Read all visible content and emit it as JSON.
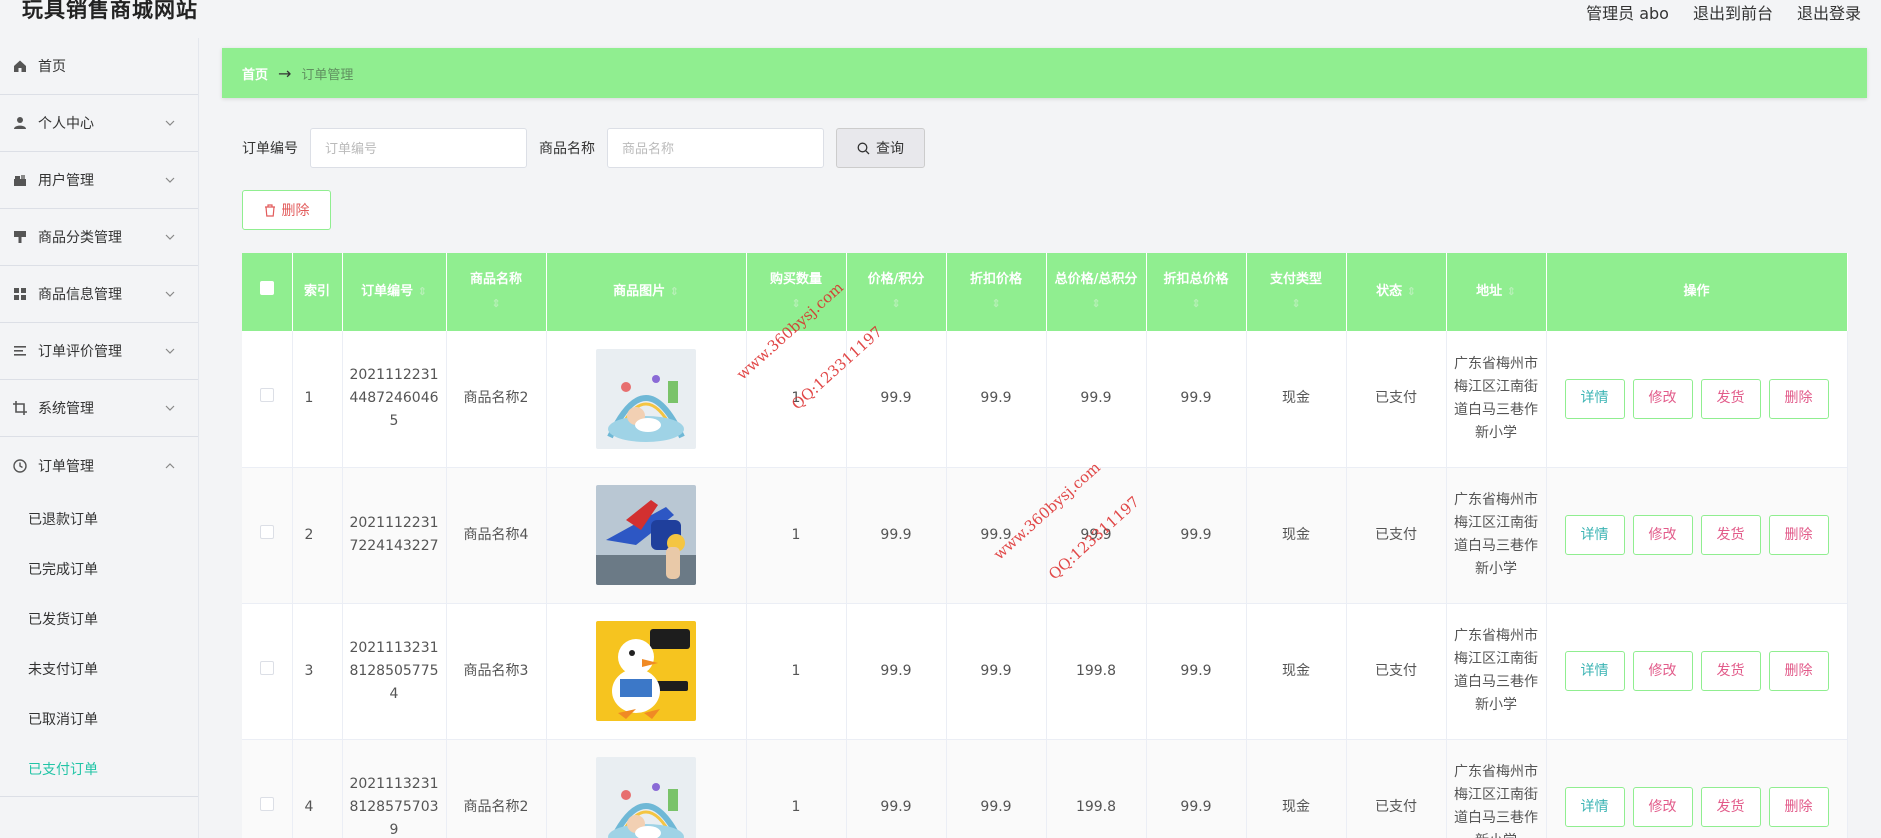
{
  "header": {
    "site_title": "玩具销售商城网站",
    "admin_label": "管理员 abo",
    "front_link": "退出到前台",
    "logout_link": "退出登录"
  },
  "sidebar": {
    "items": [
      {
        "label": "首页",
        "icon": "home-icon"
      },
      {
        "label": "个人中心",
        "icon": "user-icon"
      },
      {
        "label": "用户管理",
        "icon": "users-icon"
      },
      {
        "label": "商品分类管理",
        "icon": "category-icon"
      },
      {
        "label": "商品信息管理",
        "icon": "grid-icon"
      },
      {
        "label": "订单评价管理",
        "icon": "list-icon"
      },
      {
        "label": "系统管理",
        "icon": "crop-icon"
      },
      {
        "label": "订单管理",
        "icon": "clock-icon"
      }
    ],
    "sub_items": [
      "已退款订单",
      "已完成订单",
      "已发货订单",
      "未支付订单",
      "已取消订单",
      "已支付订单"
    ],
    "active_sub": "已支付订单"
  },
  "breadcrumb": {
    "home": "首页",
    "separator": "→",
    "current": "订单管理"
  },
  "search": {
    "order_no_label": "订单编号",
    "order_no_placeholder": "订单编号",
    "product_name_label": "商品名称",
    "product_name_placeholder": "商品名称",
    "query_button": "查询"
  },
  "actions": {
    "delete_button": "删除"
  },
  "table": {
    "columns": {
      "index": "索引",
      "order_no": "订单编号",
      "product_name": "商品名称",
      "product_image": "商品图片",
      "quantity": "购买数量",
      "price": "价格/积分",
      "discount_price": "折扣价格",
      "total": "总价格/总积分",
      "discount_total": "折扣总价格",
      "pay_type": "支付类型",
      "status": "状态",
      "address": "地址",
      "ops": "操作"
    },
    "row_actions": {
      "detail": "详情",
      "edit": "修改",
      "ship": "发货",
      "delete": "删除"
    },
    "rows": [
      {
        "index": "1",
        "order_no": "20211122314487246046 5",
        "product_name": "商品名称2",
        "image": "baby-gym-toy",
        "quantity": "1",
        "price": "99.9",
        "discount_price": "99.9",
        "total": "99.9",
        "discount_total": "99.9",
        "pay_type": "现金",
        "status": "已支付",
        "address": "广东省梅州市梅江区江南街道白马三巷作新小学"
      },
      {
        "index": "2",
        "order_no": "20211122317224143227",
        "product_name": "商品名称4",
        "image": "toy-plane-gun",
        "quantity": "1",
        "price": "99.9",
        "discount_price": "99.9",
        "total": "99.9",
        "discount_total": "99.9",
        "pay_type": "现金",
        "status": "已支付",
        "address": "广东省梅州市梅江区江南街道白马三巷作新小学"
      },
      {
        "index": "3",
        "order_no": "20211132318128505775 4",
        "product_name": "商品名称3",
        "image": "plush-duck",
        "quantity": "1",
        "price": "99.9",
        "discount_price": "99.9",
        "total": "199.8",
        "discount_total": "99.9",
        "pay_type": "现金",
        "status": "已支付",
        "address": "广东省梅州市梅江区江南街道白马三巷作新小学"
      },
      {
        "index": "4",
        "order_no": "20211132318128575703 9",
        "product_name": "商品名称2",
        "image": "baby-gym-toy",
        "quantity": "1",
        "price": "99.9",
        "discount_price": "99.9",
        "total": "199.8",
        "discount_total": "99.9",
        "pay_type": "现金",
        "status": "已支付",
        "address": "广东省梅州市梅江区江南街道白马三巷作新小学"
      }
    ]
  },
  "watermark": {
    "site": "www.360bysj.com",
    "qq": "QQ:123311197"
  },
  "colors": {
    "accent_green": "#90ee90",
    "active_teal": "#21c4a6",
    "danger": "#e25b5b"
  }
}
